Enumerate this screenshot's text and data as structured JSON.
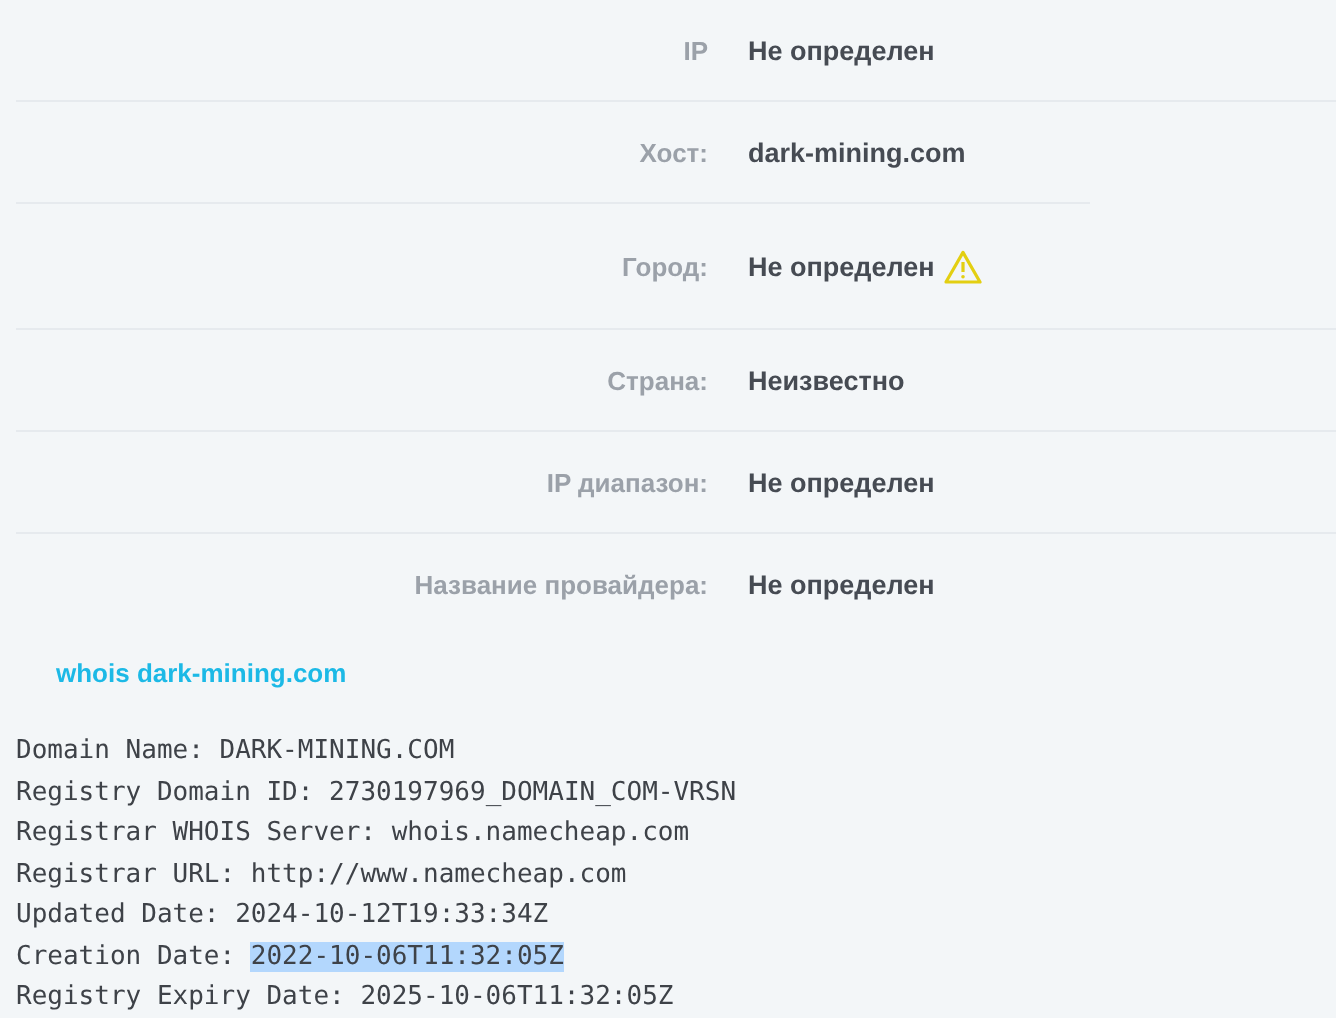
{
  "info_rows": [
    {
      "label": "IP",
      "value": "Не определен",
      "warning": false
    },
    {
      "label": "Хост:",
      "value": "dark-mining.com",
      "warning": false
    },
    {
      "label": "Город:",
      "value": "Не определен",
      "warning": true
    },
    {
      "label": "Страна:",
      "value": "Неизвестно",
      "warning": false
    },
    {
      "label": "IP диапазон:",
      "value": "Не определен",
      "warning": false
    },
    {
      "label": "Название провайдера:",
      "value": "Не определен",
      "warning": false
    }
  ],
  "whois_link": "whois dark-mining.com",
  "whois_lines": [
    {
      "key": "Domain Name:",
      "value": "DARK-MINING.COM",
      "selected": false
    },
    {
      "key": "Registry Domain ID:",
      "value": "2730197969_DOMAIN_COM-VRSN",
      "selected": false
    },
    {
      "key": "Registrar WHOIS Server:",
      "value": "whois.namecheap.com",
      "selected": false
    },
    {
      "key": "Registrar URL:",
      "value": "http://www.namecheap.com",
      "selected": false
    },
    {
      "key": "Updated Date:",
      "value": "2024-10-12T19:33:34Z",
      "selected": false
    },
    {
      "key": "Creation Date:",
      "value": "2022-10-06T11:32:05Z",
      "selected": true
    },
    {
      "key": "Registry Expiry Date:",
      "value": "2025-10-06T11:32:05Z",
      "selected": false
    }
  ]
}
